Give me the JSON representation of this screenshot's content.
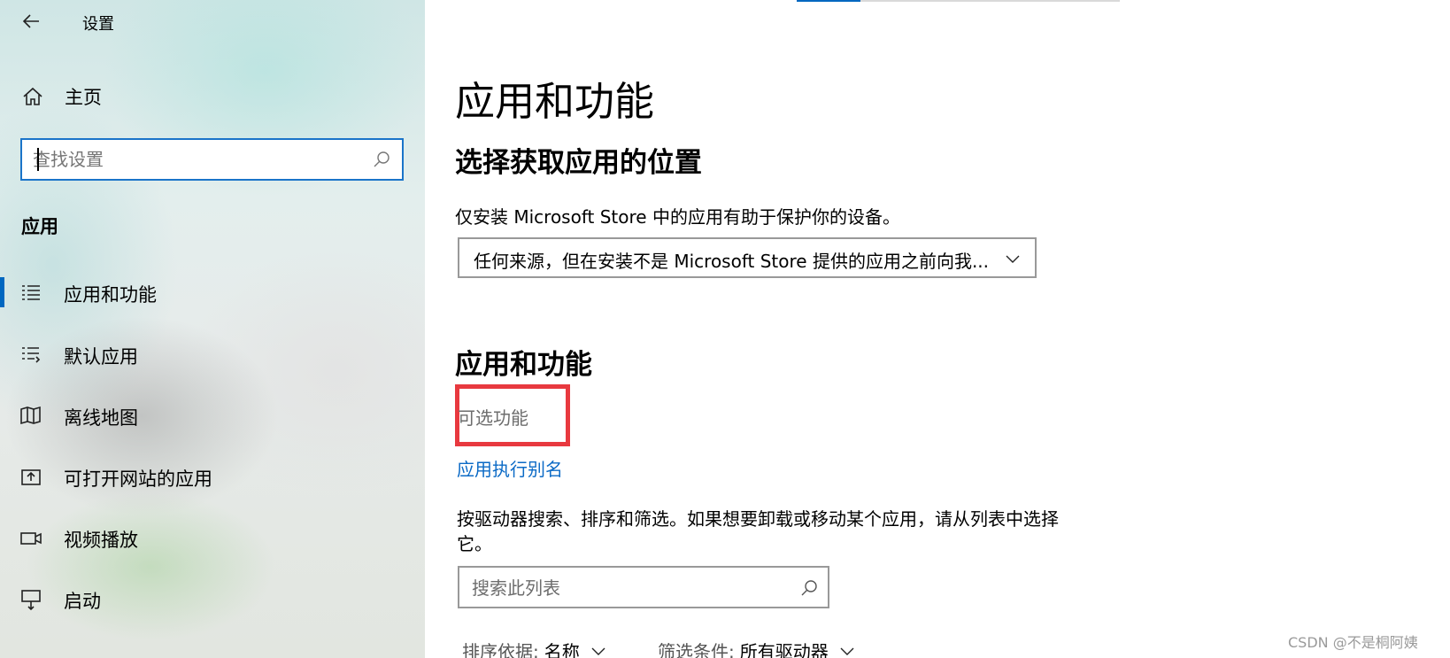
{
  "window": {
    "title": "设置"
  },
  "sidebar": {
    "home_label": "主页",
    "search_placeholder": "查找设置",
    "section": "应用",
    "items": [
      {
        "label": "应用和功能",
        "icon": "list-icon",
        "selected": true
      },
      {
        "label": "默认应用",
        "icon": "default-apps-icon",
        "selected": false
      },
      {
        "label": "离线地图",
        "icon": "map-icon",
        "selected": false
      },
      {
        "label": "可打开网站的应用",
        "icon": "open-website-icon",
        "selected": false
      },
      {
        "label": "视频播放",
        "icon": "video-icon",
        "selected": false
      },
      {
        "label": "启动",
        "icon": "startup-icon",
        "selected": false
      }
    ]
  },
  "main": {
    "title": "应用和功能",
    "install_section": {
      "heading": "选择获取应用的位置",
      "description": "仅安装 Microsoft Store 中的应用有助于保护你的设备。",
      "dropdown_value": "任何来源，但在安装不是 Microsoft Store 提供的应用之前向我..."
    },
    "apps_section": {
      "heading": "应用和功能",
      "optional_features_link": "可选功能",
      "alias_link": "应用执行别名",
      "description": "按驱动器搜索、排序和筛选。如果想要卸载或移动某个应用，请从列表中选择它。",
      "search_placeholder": "搜索此列表",
      "sort_label": "排序依据:",
      "sort_value": "名称",
      "filter_label": "筛选条件:",
      "filter_value": "所有驱动器"
    }
  },
  "watermark": "CSDN @不是桐阿姨",
  "colors": {
    "accent": "#0067c0",
    "link": "#0b6ac6",
    "highlight_box": "#e8393f"
  }
}
